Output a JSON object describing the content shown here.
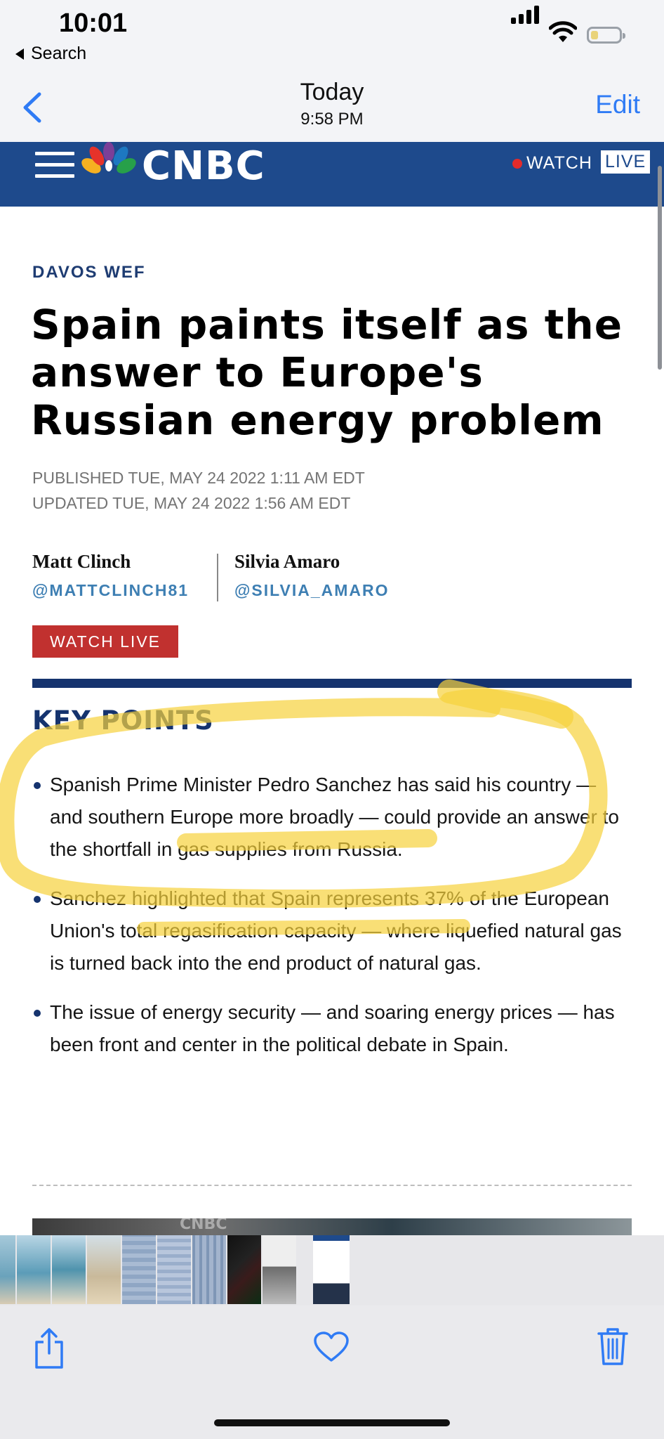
{
  "status_bar": {
    "time": "10:01",
    "back_app": "Search"
  },
  "nav": {
    "title": "Today",
    "subtitle": "9:58 PM",
    "edit": "Edit"
  },
  "cnbc": {
    "logo": "CNBC",
    "watch": "WATCH",
    "live": "LIVE"
  },
  "article": {
    "eyebrow": "DAVOS WEF",
    "headline": "Spain paints itself as the answer to Europe's Russian energy problem",
    "published": "PUBLISHED TUE, MAY 24 2022 1:11 AM EDT",
    "updated": "UPDATED TUE, MAY 24 2022 1:56 AM EDT",
    "authors": [
      {
        "name": "Matt Clinch",
        "handle": "@MATTCLINCH81"
      },
      {
        "name": "Silvia Amaro",
        "handle": "@SILVIA_AMARO"
      }
    ],
    "watch_live_button": "WATCH LIVE",
    "key_points_title": "KEY POINTS",
    "key_points": [
      "Spanish Prime Minister Pedro Sanchez has said his country — and southern Europe more broadly — could provide an answer to the shortfall in gas supplies from Russia.",
      "Sanchez highlighted that Spain represents 37% of the European Union's total regasification capacity — where liquefied natural gas is turned back into the end product of natural gas.",
      "The issue of energy security — and soaring energy prices — has been front and center in the political debate in Spain."
    ],
    "hero_peek_text": "CNBC"
  },
  "colors": {
    "cnbc_blue": "#1e4a8c",
    "ios_blue": "#2f7bf5",
    "watch_red": "#c1312f",
    "highlight": "#f7d23c"
  },
  "toolbar": {
    "share": "share-icon",
    "favorite": "heart-icon",
    "delete": "trash-icon"
  }
}
